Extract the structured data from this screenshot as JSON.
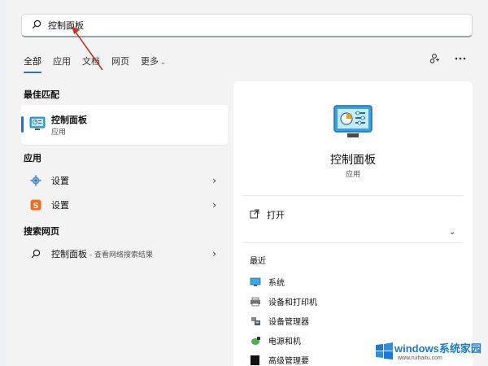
{
  "search": {
    "value": "控制面板"
  },
  "tabs": [
    {
      "label": "全部",
      "active": true
    },
    {
      "label": "应用"
    },
    {
      "label": "文档"
    },
    {
      "label": "网页"
    },
    {
      "label": "更多"
    }
  ],
  "top_icons": [
    "share-people-icon",
    "more-ellipsis-icon"
  ],
  "best_match": {
    "title": "最佳匹配",
    "name": "控制面板",
    "type": "应用"
  },
  "apps": {
    "title": "应用",
    "items": [
      {
        "label": "设置",
        "icon": "gear-icon"
      },
      {
        "label": "设置",
        "icon": "sogou-s-icon"
      }
    ]
  },
  "web": {
    "title": "搜索网页",
    "item": {
      "label": "控制面板",
      "hint": " - 查看网络搜索结果"
    }
  },
  "detail": {
    "name": "控制面板",
    "type": "应用",
    "open_label": "打开",
    "recent_title": "最近",
    "recent": [
      {
        "label": "系统",
        "icon": "system-monitor-icon"
      },
      {
        "label": "设备和打印机",
        "icon": "printer-icon"
      },
      {
        "label": "设备管理器",
        "icon": "device-manager-icon"
      },
      {
        "label": "电源和机",
        "icon": "power-icon"
      },
      {
        "label": "高级管理要",
        "icon": "black-square-icon"
      }
    ]
  },
  "watermark": {
    "title": "windows系统家园",
    "url": "www.ruihaitu.com"
  },
  "colors": {
    "accent": "#2f6ec2",
    "annotation_arrow": "#c0392b",
    "watermark": "#1c7ad0"
  }
}
